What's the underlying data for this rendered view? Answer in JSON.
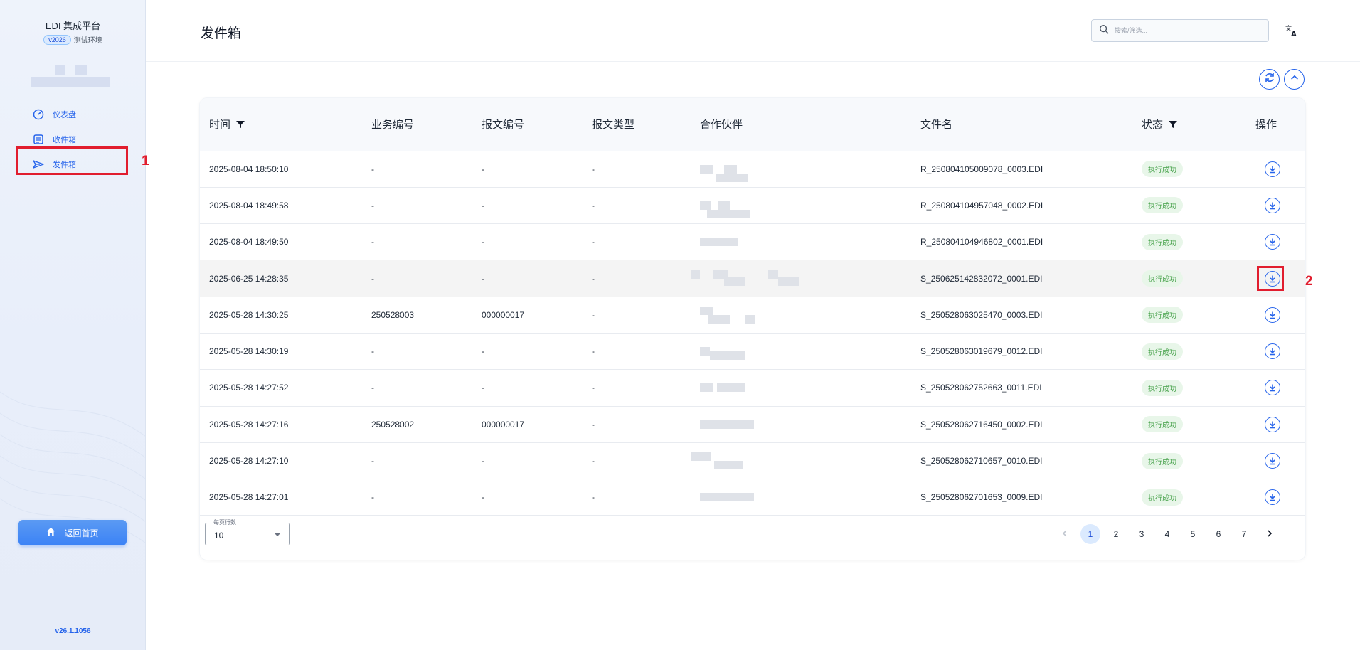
{
  "sidebar": {
    "brand_title": "EDI 集成平台",
    "version_pill": "v2026",
    "env_label": "测试环境",
    "nav": [
      {
        "label": "仪表盘",
        "icon": "speedometer-icon"
      },
      {
        "label": "收件箱",
        "icon": "inbox-icon"
      },
      {
        "label": "发件箱",
        "icon": "send-icon",
        "active": true
      }
    ],
    "home_button": "返回首页",
    "version": "v26.1.1056"
  },
  "header": {
    "title": "发件箱",
    "search_placeholder": "搜索/筛选...",
    "translate_icon": "translate-icon"
  },
  "toolbar": {
    "refresh_icon": "refresh-icon",
    "collapse_icon": "chevron-up-icon"
  },
  "table": {
    "columns": [
      "时间",
      "业务编号",
      "报文编号",
      "报文类型",
      "合作伙伴",
      "文件名",
      "状态",
      "操作"
    ],
    "rows": [
      {
        "time": "2025-08-04 18:50:10",
        "biz": "-",
        "msg": "-",
        "type": "-",
        "file": "R_250804105009078_0003.EDI",
        "status": "执行成功"
      },
      {
        "time": "2025-08-04 18:49:58",
        "biz": "-",
        "msg": "-",
        "type": "-",
        "file": "R_250804104957048_0002.EDI",
        "status": "执行成功"
      },
      {
        "time": "2025-08-04 18:49:50",
        "biz": "-",
        "msg": "-",
        "type": "-",
        "file": "R_250804104946802_0001.EDI",
        "status": "执行成功"
      },
      {
        "time": "2025-06-25 14:28:35",
        "biz": "-",
        "msg": "-",
        "type": "-",
        "file": "S_250625142832072_0001.EDI",
        "status": "执行成功"
      },
      {
        "time": "2025-05-28 14:30:25",
        "biz": "250528003",
        "msg": "000000017",
        "type": "-",
        "file": "S_250528063025470_0003.EDI",
        "status": "执行成功"
      },
      {
        "time": "2025-05-28 14:30:19",
        "biz": "-",
        "msg": "-",
        "type": "-",
        "file": "S_250528063019679_0012.EDI",
        "status": "执行成功"
      },
      {
        "time": "2025-05-28 14:27:52",
        "biz": "-",
        "msg": "-",
        "type": "-",
        "file": "S_250528062752663_0011.EDI",
        "status": "执行成功"
      },
      {
        "time": "2025-05-28 14:27:16",
        "biz": "250528002",
        "msg": "000000017",
        "type": "-",
        "file": "S_250528062716450_0002.EDI",
        "status": "执行成功"
      },
      {
        "time": "2025-05-28 14:27:10",
        "biz": "-",
        "msg": "-",
        "type": "-",
        "file": "S_250528062710657_0010.EDI",
        "status": "执行成功"
      },
      {
        "time": "2025-05-28 14:27:01",
        "biz": "-",
        "msg": "-",
        "type": "-",
        "file": "S_250528062701653_0009.EDI",
        "status": "执行成功"
      }
    ]
  },
  "pager": {
    "rows_label": "每页行数",
    "rows_value": "10",
    "pages": [
      "1",
      "2",
      "3",
      "4",
      "5",
      "6",
      "7"
    ],
    "current": "1"
  },
  "annotations": [
    "1",
    "2"
  ],
  "colors": {
    "accent": "#2563eb",
    "highlight": "#e11d2e",
    "success_bg": "#e8f6e9",
    "success_text": "#43a047"
  }
}
